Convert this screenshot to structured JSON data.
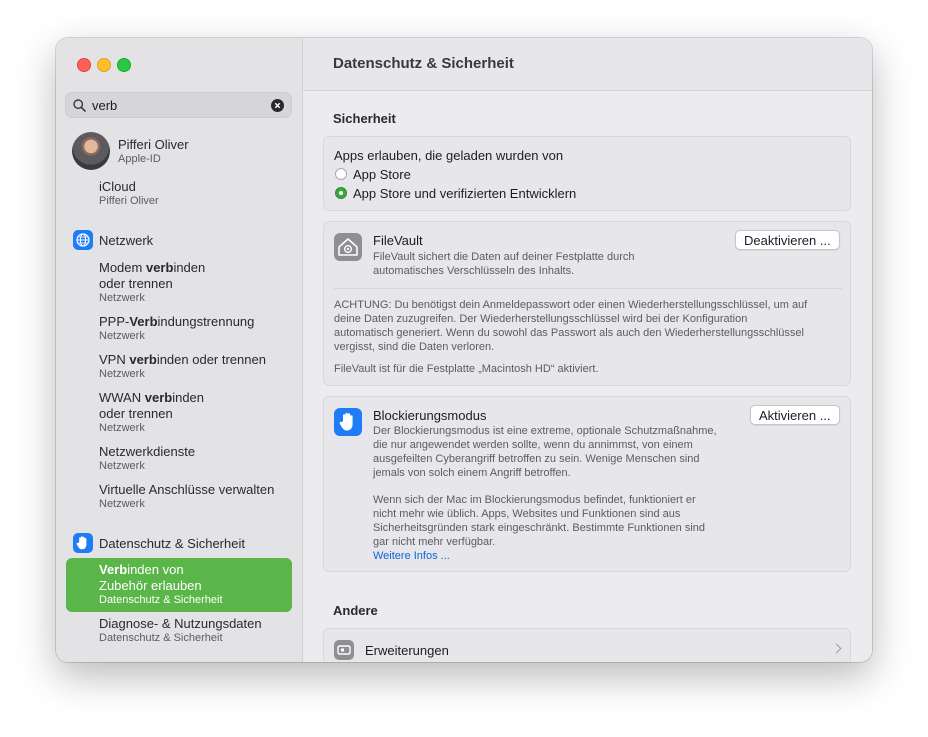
{
  "search": {
    "value": "verb",
    "icon": "magnifyingglass-icon"
  },
  "account": {
    "name": "Pifferi Oliver",
    "sub": "Apple-ID"
  },
  "icloud": {
    "title": "iCloud",
    "sub": "Pifferi Oliver"
  },
  "network": {
    "header": "Netzwerk",
    "items": [
      {
        "pre": "Modem ",
        "hl": "verb",
        "post": "inden",
        "line2": "oder trennen",
        "sub": "Netzwerk"
      },
      {
        "pre": "PPP-",
        "hl": "Verb",
        "post": "indungstrennung",
        "sub": "Netzwerk"
      },
      {
        "pre": "VPN ",
        "hl": "verb",
        "post": "inden oder trennen",
        "sub": "Netzwerk"
      },
      {
        "pre": "WWAN ",
        "hl": "verb",
        "post": "inden",
        "line2": "oder trennen",
        "sub": "Netzwerk"
      },
      {
        "pre": "Netzwerkdienste",
        "sub": "Netzwerk"
      },
      {
        "pre": "Virtuelle Anschlüsse verwalten",
        "sub": "Netzwerk"
      }
    ]
  },
  "privacy": {
    "header": "Datenschutz & Sicherheit",
    "selected": {
      "hl": "Verb",
      "post": "inden von",
      "line2": "Zubehör erlauben",
      "sub": "Datenschutz & Sicherheit"
    },
    "next": {
      "title": "Diagnose- & Nutzungsdaten",
      "sub": "Datenschutz & Sicherheit"
    }
  },
  "main": {
    "title": "Datenschutz & Sicherheit",
    "section_security": "Sicherheit",
    "apps_allow": "Apps erlauben, die geladen wurden von",
    "radio_appstore": "App Store",
    "radio_verified": "App Store und verifizierten Entwicklern",
    "filevault": {
      "title": "FileVault",
      "desc1": "FileVault sichert die Daten auf deiner Festplatte durch",
      "desc2": "automatisches Verschlüsseln des Inhalts.",
      "button": "Deaktivieren ...",
      "warn1": "ACHTUNG: Du benötigst dein Anmeldepasswort oder einen Wiederherstellungsschlüssel, um auf",
      "warn2": "deine Daten zuzugreifen. Der Wiederherstellungsschlüssel wird bei der Konfiguration",
      "warn3": "automatisch generiert. Wenn du sowohl das Passwort als auch den Wiederherstellungsschlüssel",
      "warn4": "vergisst, sind die Daten verloren.",
      "status": "FileVault ist für die Festplatte „Macintosh HD“ aktiviert."
    },
    "lockdown": {
      "title": "Blockierungsmodus",
      "button": "Aktivieren ...",
      "p1": [
        "Der Blockierungsmodus ist eine extreme, optionale Schutzmaßnahme,",
        "die nur angewendet werden sollte, wenn du annimmst, von einem",
        "ausgefeilten Cyberangriff betroffen zu sein. Wenige Menschen sind",
        "jemals von solch einem Angriff betroffen."
      ],
      "p2": [
        "Wenn sich der Mac im Blockierungsmodus befindet, funktioniert er",
        "nicht mehr wie üblich. Apps, Websites und Funktionen sind aus",
        "Sicherheitsgründen stark eingeschränkt. Bestimmte Funktionen sind",
        "gar nicht mehr verfügbar."
      ],
      "link": "Weitere Infos ..."
    },
    "section_other": "Andere",
    "extensions": "Erweiterungen"
  }
}
